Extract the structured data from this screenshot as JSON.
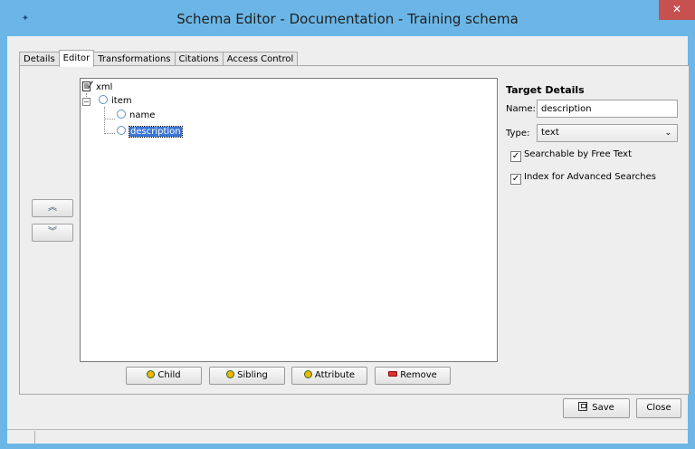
{
  "window": {
    "title": "Schema Editor - Documentation - Training schema",
    "close_label": "✕"
  },
  "tabs": [
    {
      "label": "Details",
      "active": false
    },
    {
      "label": "Editor",
      "active": true
    },
    {
      "label": "Transformations",
      "active": false
    },
    {
      "label": "Citations",
      "active": false
    },
    {
      "label": "Access Control",
      "active": false
    }
  ],
  "tree": {
    "root": "xml",
    "item": "item",
    "name": "name",
    "description": "description"
  },
  "move": {
    "up": "︽",
    "down": "︾"
  },
  "actions": {
    "child": "Child",
    "sibling": "Sibling",
    "attribute": "Attribute",
    "remove": "Remove"
  },
  "details": {
    "title": "Target Details",
    "name_label": "Name:",
    "name_value": "description",
    "type_label": "Type:",
    "type_value": "text",
    "searchable_label": "Searchable by Free Text",
    "searchable_checked": true,
    "index_label": "Index for Advanced Searches",
    "index_checked": true
  },
  "footer": {
    "save": "Save",
    "close": "Close"
  },
  "colors": {
    "titlebar": "#6bb6e6",
    "close": "#c75050",
    "selection": "#3875d7"
  }
}
